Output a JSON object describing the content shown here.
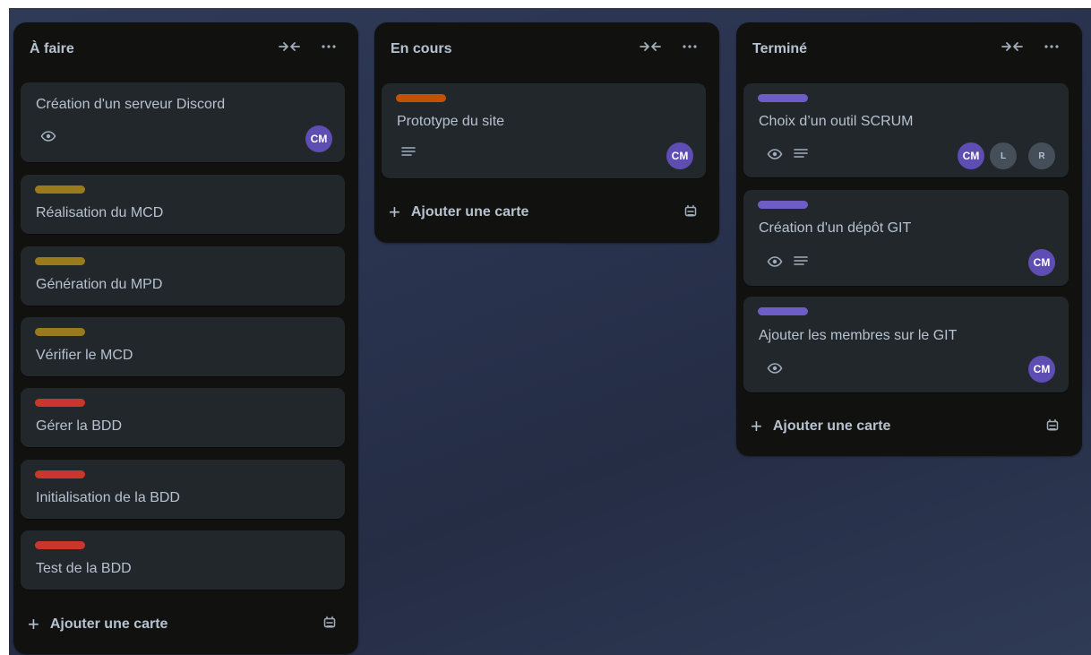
{
  "colors": {
    "label_yellow": "#9a7b1b",
    "label_red": "#c9372c",
    "label_orange": "#c25100",
    "label_purple": "#6e5dc6",
    "avatar_cm": "#5e4db2",
    "avatar_grey": "#454f59"
  },
  "lists": [
    {
      "title": "À faire",
      "add_label": "Ajouter une carte",
      "cards": [
        {
          "title": "Création d'un serveur Discord",
          "badges": [
            "eye-icon"
          ],
          "members": [
            "CM"
          ]
        },
        {
          "title": "Réalisation du MCD",
          "label": "yellow"
        },
        {
          "title": "Génération du MPD",
          "label": "yellow"
        },
        {
          "title": "Vérifier le MCD",
          "label": "yellow"
        },
        {
          "title": "Gérer la BDD",
          "label": "red"
        },
        {
          "title": "Initialisation de la BDD",
          "label": "red"
        },
        {
          "title": "Test de la BDD",
          "label": "red"
        }
      ]
    },
    {
      "title": "En cours",
      "add_label": "Ajouter une carte",
      "cards": [
        {
          "title": "Prototype du site",
          "label": "orange",
          "badges": [
            "description-icon"
          ],
          "members": [
            "CM"
          ]
        }
      ]
    },
    {
      "title": "Terminé",
      "add_label": "Ajouter une carte",
      "cards": [
        {
          "title": "Choix d’un outil SCRUM",
          "label": "purple",
          "badges": [
            "eye-icon",
            "description-icon"
          ],
          "members": [
            "CM",
            "L",
            "R"
          ]
        },
        {
          "title": "Création d'un dépôt GIT",
          "label": "purple",
          "badges": [
            "eye-icon",
            "description-icon"
          ],
          "members": [
            "CM"
          ]
        },
        {
          "title": "Ajouter les membres sur le GIT",
          "label": "purple",
          "badges": [
            "eye-icon"
          ],
          "members": [
            "CM"
          ]
        }
      ]
    }
  ]
}
